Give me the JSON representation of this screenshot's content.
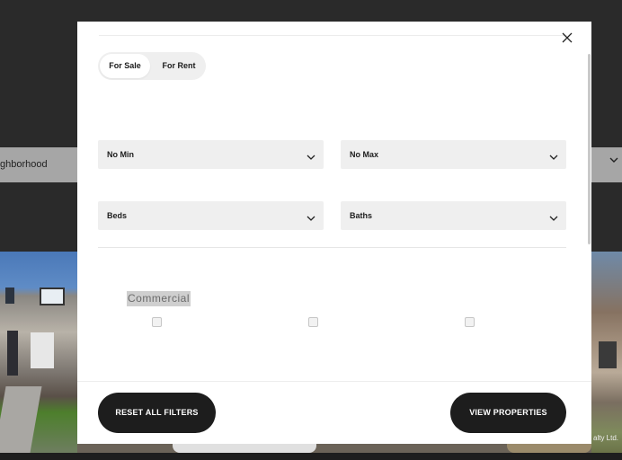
{
  "background": {
    "neighborhood_text": "ghborhood",
    "credit_text": "alty Ltd."
  },
  "modal": {
    "listing_toggle": {
      "options": [
        "For Sale",
        "For Rent"
      ],
      "selected": "For Sale"
    },
    "price": {
      "min_label": "No Min",
      "max_label": "No Max"
    },
    "rooms": {
      "beds_label": "Beds",
      "baths_label": "Baths"
    },
    "property_type": {
      "label": "Commercial",
      "checkboxes": [
        false,
        false,
        false
      ]
    },
    "actions": {
      "reset_label": "RESET ALL FILTERS",
      "view_label": "VIEW PROPERTIES"
    }
  },
  "colors": {
    "overlay": "#2a2a2a",
    "modal_bg": "#ffffff",
    "field_bg": "#efefef",
    "button_bg": "#1d1d1d",
    "button_text": "#ffffff"
  },
  "icons": {
    "close": "close-icon",
    "dropdown": "chevron-down-icon"
  }
}
